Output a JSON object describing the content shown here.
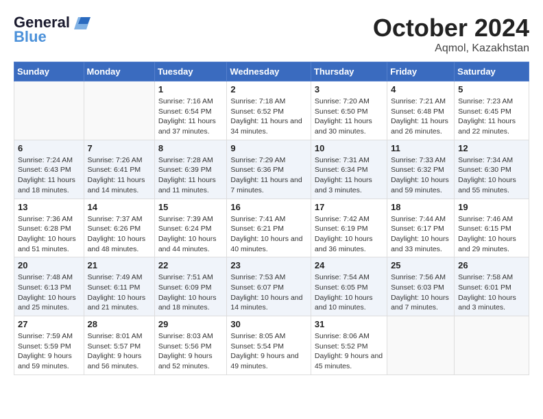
{
  "logo": {
    "line1": "General",
    "line2": "Blue"
  },
  "title": "October 2024",
  "location": "Aqmol, Kazakhstan",
  "weekdays": [
    "Sunday",
    "Monday",
    "Tuesday",
    "Wednesday",
    "Thursday",
    "Friday",
    "Saturday"
  ],
  "weeks": [
    [
      {
        "day": "",
        "content": ""
      },
      {
        "day": "",
        "content": ""
      },
      {
        "day": "1",
        "content": "Sunrise: 7:16 AM\nSunset: 6:54 PM\nDaylight: 11 hours and 37 minutes."
      },
      {
        "day": "2",
        "content": "Sunrise: 7:18 AM\nSunset: 6:52 PM\nDaylight: 11 hours and 34 minutes."
      },
      {
        "day": "3",
        "content": "Sunrise: 7:20 AM\nSunset: 6:50 PM\nDaylight: 11 hours and 30 minutes."
      },
      {
        "day": "4",
        "content": "Sunrise: 7:21 AM\nSunset: 6:48 PM\nDaylight: 11 hours and 26 minutes."
      },
      {
        "day": "5",
        "content": "Sunrise: 7:23 AM\nSunset: 6:45 PM\nDaylight: 11 hours and 22 minutes."
      }
    ],
    [
      {
        "day": "6",
        "content": "Sunrise: 7:24 AM\nSunset: 6:43 PM\nDaylight: 11 hours and 18 minutes."
      },
      {
        "day": "7",
        "content": "Sunrise: 7:26 AM\nSunset: 6:41 PM\nDaylight: 11 hours and 14 minutes."
      },
      {
        "day": "8",
        "content": "Sunrise: 7:28 AM\nSunset: 6:39 PM\nDaylight: 11 hours and 11 minutes."
      },
      {
        "day": "9",
        "content": "Sunrise: 7:29 AM\nSunset: 6:36 PM\nDaylight: 11 hours and 7 minutes."
      },
      {
        "day": "10",
        "content": "Sunrise: 7:31 AM\nSunset: 6:34 PM\nDaylight: 11 hours and 3 minutes."
      },
      {
        "day": "11",
        "content": "Sunrise: 7:33 AM\nSunset: 6:32 PM\nDaylight: 10 hours and 59 minutes."
      },
      {
        "day": "12",
        "content": "Sunrise: 7:34 AM\nSunset: 6:30 PM\nDaylight: 10 hours and 55 minutes."
      }
    ],
    [
      {
        "day": "13",
        "content": "Sunrise: 7:36 AM\nSunset: 6:28 PM\nDaylight: 10 hours and 51 minutes."
      },
      {
        "day": "14",
        "content": "Sunrise: 7:37 AM\nSunset: 6:26 PM\nDaylight: 10 hours and 48 minutes."
      },
      {
        "day": "15",
        "content": "Sunrise: 7:39 AM\nSunset: 6:24 PM\nDaylight: 10 hours and 44 minutes."
      },
      {
        "day": "16",
        "content": "Sunrise: 7:41 AM\nSunset: 6:21 PM\nDaylight: 10 hours and 40 minutes."
      },
      {
        "day": "17",
        "content": "Sunrise: 7:42 AM\nSunset: 6:19 PM\nDaylight: 10 hours and 36 minutes."
      },
      {
        "day": "18",
        "content": "Sunrise: 7:44 AM\nSunset: 6:17 PM\nDaylight: 10 hours and 33 minutes."
      },
      {
        "day": "19",
        "content": "Sunrise: 7:46 AM\nSunset: 6:15 PM\nDaylight: 10 hours and 29 minutes."
      }
    ],
    [
      {
        "day": "20",
        "content": "Sunrise: 7:48 AM\nSunset: 6:13 PM\nDaylight: 10 hours and 25 minutes."
      },
      {
        "day": "21",
        "content": "Sunrise: 7:49 AM\nSunset: 6:11 PM\nDaylight: 10 hours and 21 minutes."
      },
      {
        "day": "22",
        "content": "Sunrise: 7:51 AM\nSunset: 6:09 PM\nDaylight: 10 hours and 18 minutes."
      },
      {
        "day": "23",
        "content": "Sunrise: 7:53 AM\nSunset: 6:07 PM\nDaylight: 10 hours and 14 minutes."
      },
      {
        "day": "24",
        "content": "Sunrise: 7:54 AM\nSunset: 6:05 PM\nDaylight: 10 hours and 10 minutes."
      },
      {
        "day": "25",
        "content": "Sunrise: 7:56 AM\nSunset: 6:03 PM\nDaylight: 10 hours and 7 minutes."
      },
      {
        "day": "26",
        "content": "Sunrise: 7:58 AM\nSunset: 6:01 PM\nDaylight: 10 hours and 3 minutes."
      }
    ],
    [
      {
        "day": "27",
        "content": "Sunrise: 7:59 AM\nSunset: 5:59 PM\nDaylight: 9 hours and 59 minutes."
      },
      {
        "day": "28",
        "content": "Sunrise: 8:01 AM\nSunset: 5:57 PM\nDaylight: 9 hours and 56 minutes."
      },
      {
        "day": "29",
        "content": "Sunrise: 8:03 AM\nSunset: 5:56 PM\nDaylight: 9 hours and 52 minutes."
      },
      {
        "day": "30",
        "content": "Sunrise: 8:05 AM\nSunset: 5:54 PM\nDaylight: 9 hours and 49 minutes."
      },
      {
        "day": "31",
        "content": "Sunrise: 8:06 AM\nSunset: 5:52 PM\nDaylight: 9 hours and 45 minutes."
      },
      {
        "day": "",
        "content": ""
      },
      {
        "day": "",
        "content": ""
      }
    ]
  ]
}
